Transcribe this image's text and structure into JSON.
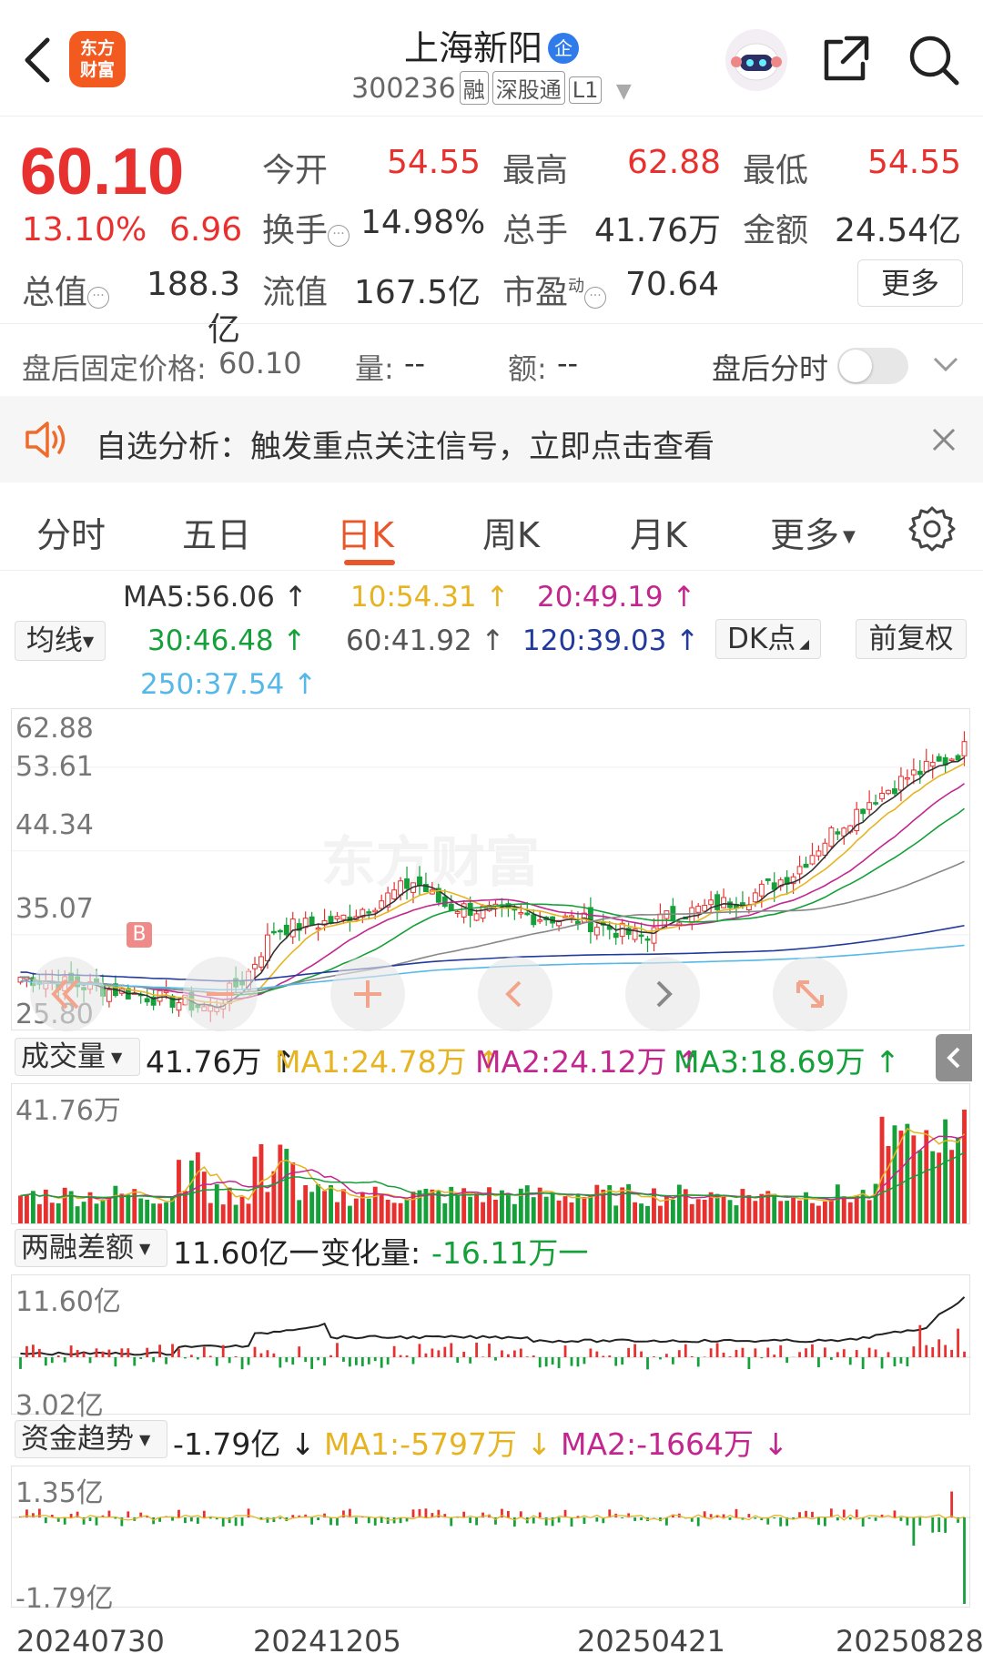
{
  "header": {
    "logo_line1": "东方",
    "logo_line2": "财富",
    "stock_name": "上海新阳",
    "name_badge": "企",
    "stock_code": "300236",
    "tags": [
      "融",
      "深股通",
      "L1"
    ]
  },
  "quote": {
    "price": "60.10",
    "change_pct": "13.10%",
    "change_amt": "6.96",
    "fields": [
      {
        "label": "今开",
        "value": "54.55"
      },
      {
        "label": "最高",
        "value": "62.88"
      },
      {
        "label": "最低",
        "value": "54.55"
      },
      {
        "label": "换手",
        "value": "14.98%"
      },
      {
        "label": "总手",
        "value": "41.76万"
      },
      {
        "label": "金额",
        "value": "24.54亿"
      },
      {
        "label": "总值",
        "value": "188.3亿"
      },
      {
        "label": "流值",
        "value": "167.5亿"
      },
      {
        "label": "市盈",
        "sup": "动",
        "value": "70.64"
      }
    ],
    "more_label": "更多"
  },
  "after_hours": {
    "label": "盘后固定价格:",
    "price": "60.10",
    "vol_label": "量:",
    "vol": "--",
    "amt_label": "额:",
    "amt": "--",
    "toggle_label": "盘后分时"
  },
  "banner": {
    "text": "自选分析：触发重点关注信号，立即点击查看"
  },
  "tabs": [
    "分时",
    "五日",
    "日K",
    "周K",
    "月K",
    "更多"
  ],
  "ma_panel": {
    "dropdown": "均线",
    "items": [
      {
        "text": "MA5:56.06 ↑",
        "color": "#333333"
      },
      {
        "text": "10:54.31 ↑",
        "color": "#e6b422"
      },
      {
        "text": "20:49.19 ↑",
        "color": "#c2278f"
      },
      {
        "text": "30:46.48 ↑",
        "color": "#15a03a"
      },
      {
        "text": "60:41.92 ↑",
        "color": "#555555"
      },
      {
        "text": "120:39.03 ↑",
        "color": "#213a9c"
      },
      {
        "text": "250:37.54 ↑",
        "color": "#55b8e8"
      }
    ],
    "dk_button": "DK点",
    "adjust_button": "前复权"
  },
  "kline": {
    "y_labels": [
      "62.88",
      "53.61",
      "44.34",
      "35.07",
      "25.80"
    ],
    "marker": "B",
    "watermark": "东方财富"
  },
  "volume": {
    "dropdown": "成交量",
    "value": "41.76万 ↑",
    "ma1": "MA1:24.78万 ↑",
    "ma2": "MA2:24.12万 ↑",
    "ma3": "MA3:18.69万 ↑",
    "y_top": "41.76万"
  },
  "margin": {
    "dropdown": "两融差额",
    "value": "11.60亿一",
    "change_label": "变化量:",
    "change_value": "-16.11万一",
    "y_top": "11.60亿",
    "y_bottom": "3.02亿"
  },
  "fund": {
    "dropdown": "资金趋势",
    "value": "-1.79亿 ↓",
    "ma1": "MA1:-5797万 ↓",
    "ma2": "MA2:-1664万 ↓",
    "y_top": "1.35亿",
    "y_bottom": "-1.79亿"
  },
  "dates": [
    "20240730",
    "20241205",
    "20250421",
    "20250828"
  ],
  "colors": {
    "up": "#e8312f",
    "down": "#15a03a",
    "accent": "#e8562a",
    "brand": "#f35a20"
  }
}
